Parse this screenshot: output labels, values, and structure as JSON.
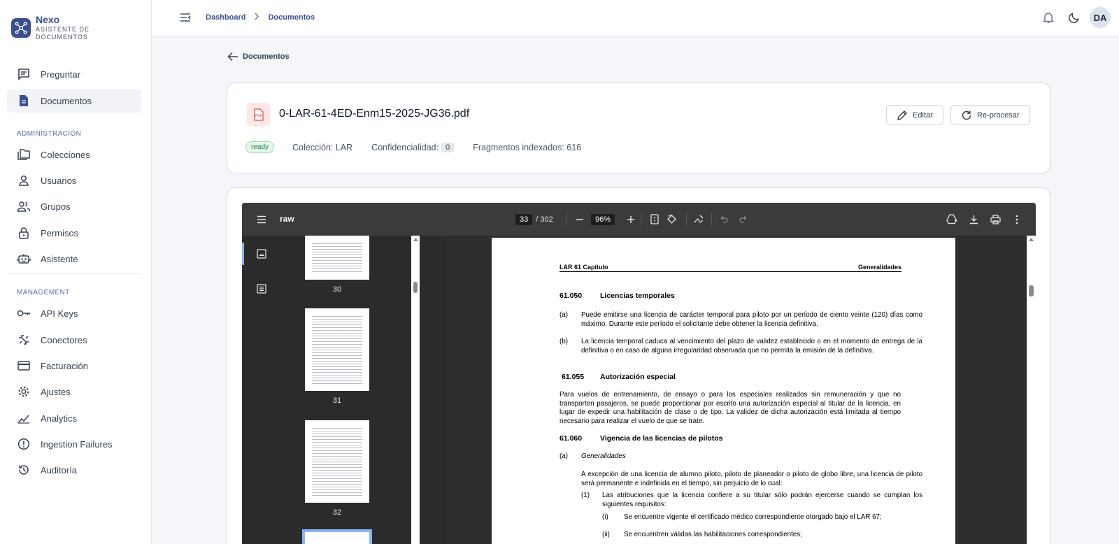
{
  "brand": {
    "name": "Nexo",
    "subtitle": "Asistente de documentos"
  },
  "sidebar": {
    "primary": [
      {
        "label": "Preguntar",
        "icon": "chat-icon"
      },
      {
        "label": "Documentos",
        "icon": "document-icon",
        "active": true
      }
    ],
    "admin_title": "ADMINISTRACIÓN",
    "admin": [
      {
        "label": "Colecciones",
        "icon": "folders-icon"
      },
      {
        "label": "Usuarios",
        "icon": "user-icon"
      },
      {
        "label": "Grupos",
        "icon": "group-icon"
      },
      {
        "label": "Permisos",
        "icon": "lock-icon"
      },
      {
        "label": "Asistente",
        "icon": "robot-icon"
      }
    ],
    "management_title": "MANAGEMENT",
    "management": [
      {
        "label": "API Keys",
        "icon": "key-icon"
      },
      {
        "label": "Conectores",
        "icon": "connector-icon"
      },
      {
        "label": "Facturación",
        "icon": "credit-card-icon"
      },
      {
        "label": "Ajustes",
        "icon": "gear-icon"
      },
      {
        "label": "Analytics",
        "icon": "analytics-icon"
      },
      {
        "label": "Ingestion Failures",
        "icon": "alert-circle-icon"
      },
      {
        "label": "Auditoría",
        "icon": "history-icon"
      }
    ]
  },
  "header": {
    "breadcrumbs": [
      "Dashboard",
      "Documentos"
    ],
    "avatar": "DA"
  },
  "back_link": "Documentos",
  "document": {
    "title": "0-LAR-61-4ED-Enm15-2025-JG36.pdf",
    "status": "ready",
    "collection": "Colección: LAR",
    "confidentiality_label": "Confidencialidad:",
    "confidentiality_value": "0",
    "fragments": "Fragmentos indexados: 616",
    "edit_label": "Editar",
    "reprocess_label": "Re-procesar"
  },
  "viewer": {
    "title": "raw",
    "current_page": "33",
    "total_pages": "/ 302",
    "zoom": "96%",
    "thumbnails": [
      "30",
      "31",
      "32"
    ]
  },
  "pdf_page": {
    "header_left": "LAR 61 Capítulo",
    "header_right": "Generalidades",
    "s1_num": "61.050",
    "s1_title": "Licencias temporales",
    "a_label": "(a)",
    "s1_a": "Puede emitirse una licencia de carácter temporal para piloto por un período de ciento veinte (120) días como máximo. Durante este período el solicitante debe obtener la licencia definitiva.",
    "b_label": "(b)",
    "s1_b": "La licencia temporal caduca al vencimiento del plazo de validez establecido o en el momento de entrega de la definitiva o en caso de alguna irregularidad observada que no permita la emisión de la definitiva.",
    "s2_num": "61.055",
    "s2_title": "Autorización especial",
    "s2_p": "Para vuelos de entrenamiento, de ensayo o para los especiales realizados sin remuneración y que no transporten pasajeros, se puede proporcionar por escrito una autorización especial al titular de la licencia, en lugar de expedir una habilitación de clase o de tipo. La validez de dicha autorización está limitada al tiempo necesario para realizar el vuelo de que se trate.",
    "s3_num": "61.060",
    "s3_title": "Vigencia de las licencias de pilotos",
    "s3_a_label": "(a)",
    "s3_a_title": "Generalidades",
    "s3_a_p": "A excepción de una licencia de alumno piloto, piloto de planeador o piloto de globo libre, una licencia de piloto será permanente e indefinida en el tiempo, sin perjuicio de lo cual:",
    "n1_label": "(1)",
    "n1": "Las atribuciones que la licencia confiere a su titular sólo podrán ejercerse cuando se cumplan los siguientes requisitos:",
    "i_label": "(i)",
    "i": "Se encuentre vigente el certificado médico correspondiente otorgado bajo el LAR 67;",
    "ii_label": "(ii)",
    "ii": "Se encuentren válidas las habilitaciones correspondientes;"
  }
}
